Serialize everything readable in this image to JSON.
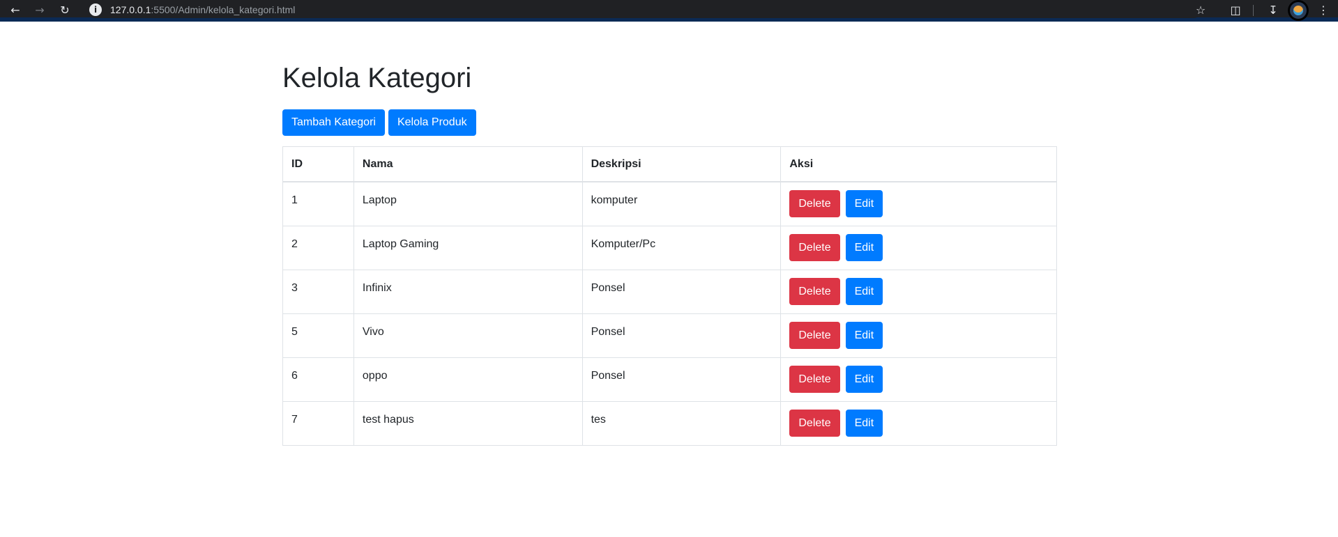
{
  "browser": {
    "url_host": "127.0.0.1",
    "url_path": ":5500/Admin/kelola_kategori.html",
    "icons": [
      "back-icon",
      "forward-icon",
      "reload-icon",
      "site-info-icon",
      "star-icon",
      "extensions-icon",
      "download-icon",
      "profile-avatar",
      "more-icon"
    ]
  },
  "page": {
    "title": "Kelola Kategori",
    "buttons": {
      "add_category": "Tambah Kategori",
      "manage_products": "Kelola Produk"
    }
  },
  "table": {
    "headers": [
      "ID",
      "Nama",
      "Deskripsi",
      "Aksi"
    ],
    "delete_label": "Delete",
    "edit_label": "Edit",
    "rows": [
      {
        "id": "1",
        "nama": "Laptop",
        "deskripsi": "komputer"
      },
      {
        "id": "2",
        "nama": "Laptop Gaming",
        "deskripsi": "Komputer/Pc"
      },
      {
        "id": "3",
        "nama": "Infinix",
        "deskripsi": "Ponsel"
      },
      {
        "id": "5",
        "nama": "Vivo",
        "deskripsi": "Ponsel"
      },
      {
        "id": "6",
        "nama": "oppo",
        "deskripsi": "Ponsel"
      },
      {
        "id": "7",
        "nama": "test hapus",
        "deskripsi": "tes"
      }
    ]
  },
  "colors": {
    "primary": "#007bff",
    "danger": "#dc3545",
    "border": "#dee2e6",
    "text": "#212529"
  }
}
